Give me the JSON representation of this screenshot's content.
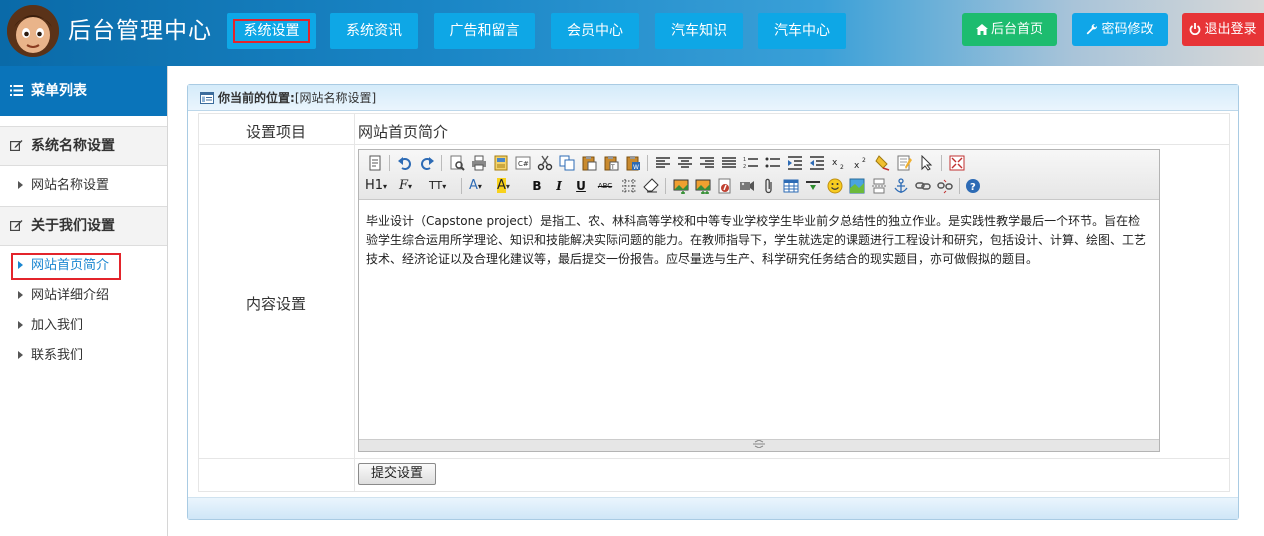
{
  "header": {
    "brand": "后台管理中心",
    "nav": [
      "系统设置",
      "系统资讯",
      "广告和留言",
      "会员中心",
      "汽车知识",
      "汽车中心"
    ],
    "active_nav": "系统设置",
    "right_buttons": [
      {
        "label": "后台首页",
        "icon": "home-icon",
        "color": "#1dbc6f"
      },
      {
        "label": "密码修改",
        "icon": "wrench-icon",
        "color": "#10a6e8"
      },
      {
        "label": "退出登录",
        "icon": "power-icon",
        "color": "#e73437"
      }
    ]
  },
  "sidebar": {
    "title": "菜单列表",
    "groups": [
      {
        "title": "系统名称设置",
        "items": [
          "网站名称设置"
        ]
      },
      {
        "title": "关于我们设置",
        "items": [
          "网站首页简介",
          "网站详细介绍",
          "加入我们",
          "联系我们"
        ]
      }
    ],
    "active_item": "网站首页简介"
  },
  "panel": {
    "location_label": "你当前的位置:",
    "location_value": "[网站名称设置]",
    "row1_label": "设置项目",
    "row1_value": "网站首页简介",
    "row2_label": "内容设置",
    "editor_content": "毕业设计（Capstone project）是指工、农、林科高等学校和中等专业学校学生毕业前夕总结性的独立作业。是实践性教学最后一个环节。旨在检验学生综合运用所学理论、知识和技能解决实际问题的能力。在教师指导下，学生就选定的课题进行工程设计和研究，包括设计、计算、绘图、工艺技术、经济论证以及合理化建议等，最后提交一份报告。应尽量选与生产、科学研究任务结合的现实题目，亦可做假拟的题目。",
    "submit_label": "提交设置"
  },
  "editor_toolbar": {
    "row1": [
      "source-icon",
      "undo-icon",
      "redo-icon",
      "preview-icon",
      "print-icon",
      "template-icon",
      "code-icon",
      "cut-icon",
      "copy-icon",
      "paste-icon",
      "paste-text-icon",
      "paste-word-icon",
      "align-left-icon",
      "align-center-icon",
      "align-right-icon",
      "justify-icon",
      "ordered-list-icon",
      "unordered-list-icon",
      "indent-icon",
      "outdent-icon",
      "subscript-icon",
      "superscript-icon",
      "clear-format-icon",
      "select-all-icon",
      "cursor-icon",
      "fullscreen-icon"
    ],
    "row2_labels": {
      "heading": "H1",
      "font": "F",
      "size": "TT",
      "bold": "B",
      "italic": "I",
      "underline": "U",
      "strike": "ABC"
    },
    "row2_icons": [
      "font-color-icon",
      "highlight-icon",
      "bold-icon",
      "italic-icon",
      "underline-icon",
      "strikethrough-icon",
      "line-height-icon",
      "remove-format-icon",
      "image-icon",
      "multi-image-icon",
      "flash-icon",
      "media-icon",
      "attachment-icon",
      "table-icon",
      "hr-icon",
      "emoticon-icon",
      "baidu-map-icon",
      "pagebreak-icon",
      "anchor-icon",
      "link-icon",
      "unlink-icon",
      "help-icon"
    ]
  }
}
